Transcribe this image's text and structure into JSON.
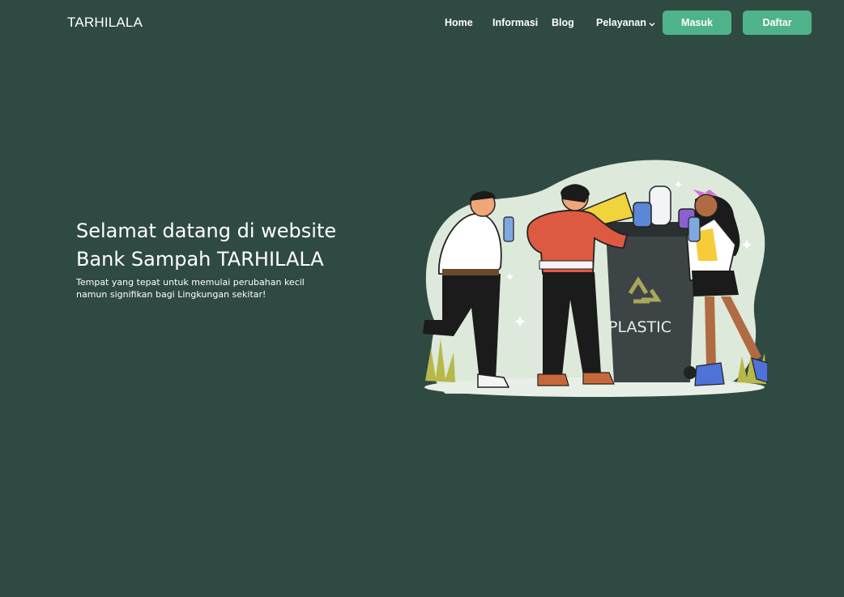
{
  "brand": "TARHILALA",
  "nav": {
    "home": "Home",
    "informasi": "Informasi",
    "blog": "Blog",
    "pelayanan": "Pelayanan"
  },
  "buttons": {
    "masuk": "Masuk",
    "daftar": "Daftar"
  },
  "hero": {
    "title_line1": "Selamat datang di website",
    "title_line2": "Bank Sampah TARHILALA",
    "subtitle": "Tempat yang tepat untuk memulai perubahan kecil namun signifikan bagi Lingkungan sekitar!"
  },
  "illustration": {
    "bin_label": "PLASTIC",
    "recycle_icon": "recycle-icon"
  },
  "colors": {
    "background": "#2f4a43",
    "accent": "#4fb38a",
    "blob": "#dde9da"
  }
}
